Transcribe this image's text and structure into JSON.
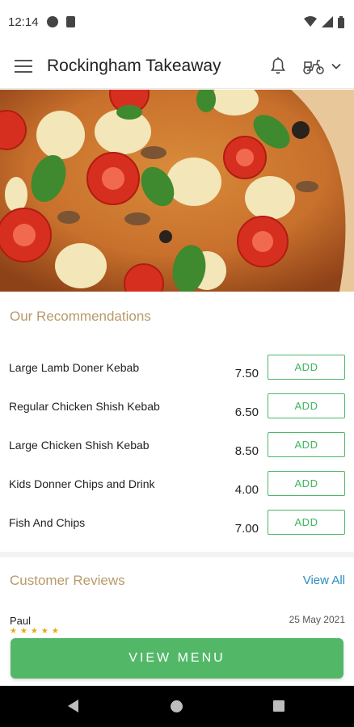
{
  "status": {
    "time": "12:14"
  },
  "header": {
    "title": "Rockingham Takeaway"
  },
  "recommendations": {
    "title": "Our Recommendations",
    "items": [
      {
        "name": "Large Lamb Doner Kebab",
        "price": "7.50",
        "button": "ADD"
      },
      {
        "name": "Regular Chicken Shish Kebab",
        "price": "6.50",
        "button": "ADD"
      },
      {
        "name": "Large Chicken Shish Kebab",
        "price": "8.50",
        "button": "ADD"
      },
      {
        "name": "Kids Donner Chips and Drink",
        "price": "4.00",
        "button": "ADD"
      },
      {
        "name": "Fish And Chips",
        "price": "7.00",
        "button": "ADD"
      }
    ]
  },
  "reviews": {
    "title": "Customer Reviews",
    "view_all": "View All",
    "first": {
      "name": "Paul",
      "date": "25 May 2021",
      "stars": "★★★★★"
    }
  },
  "cta": {
    "label": "VIEW MENU"
  },
  "colors": {
    "accent_green": "#52b868",
    "section_title": "#b89a6a",
    "link_blue": "#2a8fc1"
  }
}
